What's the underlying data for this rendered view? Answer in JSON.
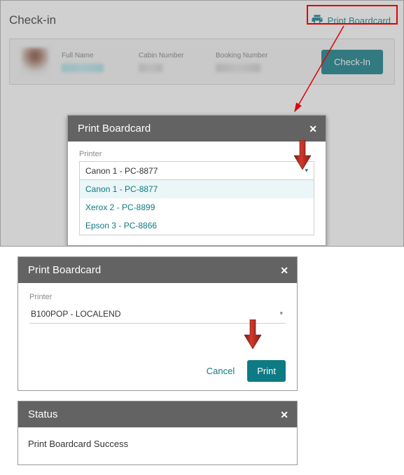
{
  "colors": {
    "accent": "#0d7a84",
    "highlight": "#e20000"
  },
  "checkin": {
    "title": "Check-in",
    "print_link": "Print Boardcard",
    "cols": {
      "fullname_label": "Full Name",
      "cabin_label": "Cabin Number",
      "booking_label": "Booking Number"
    },
    "checkin_btn": "Check-In"
  },
  "modal1": {
    "title": "Print Boardcard",
    "printer_label": "Printer",
    "selected": "Canon 1 - PC-8877",
    "options": {
      "0": "Canon 1 - PC-8877",
      "1": "Xerox 2 - PC-8899",
      "2": "Epson 3 - PC-8866"
    }
  },
  "modal2": {
    "title": "Print Boardcard",
    "printer_label": "Printer",
    "selected": "B100POP - LOCALEND",
    "cancel": "Cancel",
    "print": "Print"
  },
  "status": {
    "title": "Status",
    "message": "Print Boardcard Success"
  }
}
